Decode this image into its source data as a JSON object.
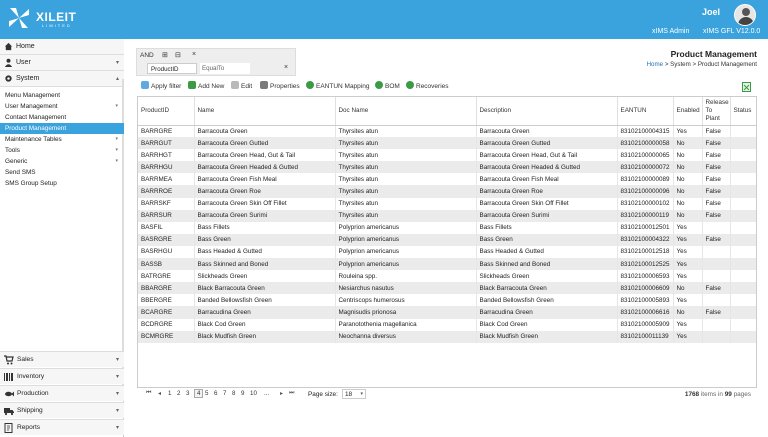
{
  "header": {
    "logo_text": "XILEIT",
    "logo_subtext": "LIMITED",
    "user_name": "Joel",
    "role": "xIMS Admin",
    "version": "xIMS GFL V12.0.0"
  },
  "sidebar": {
    "top": [
      {
        "label": "Home",
        "icon": "home-icon"
      },
      {
        "label": "User",
        "icon": "user-icon"
      },
      {
        "label": "System",
        "icon": "gear-icon"
      }
    ],
    "system_items": [
      {
        "label": "Menu Management",
        "chevron": false,
        "active": false
      },
      {
        "label": "User Management",
        "chevron": true,
        "active": false
      },
      {
        "label": "Contact Management",
        "chevron": false,
        "active": false
      },
      {
        "label": "Product Management",
        "chevron": false,
        "active": true
      },
      {
        "label": "Maintenance Tables",
        "chevron": true,
        "active": false
      },
      {
        "label": "Tools",
        "chevron": true,
        "active": false
      },
      {
        "label": "Generic",
        "chevron": true,
        "active": false
      },
      {
        "label": "Send SMS",
        "chevron": false,
        "active": false
      },
      {
        "label": "SMS Group Setup",
        "chevron": false,
        "active": false
      }
    ],
    "bottom": [
      {
        "label": "Sales",
        "icon": "cart-icon"
      },
      {
        "label": "Inventory",
        "icon": "barcode-icon"
      },
      {
        "label": "Production",
        "icon": "fish-icon"
      },
      {
        "label": "Shipping",
        "icon": "truck-icon"
      },
      {
        "label": "Reports",
        "icon": "report-icon"
      }
    ]
  },
  "filter_panel": {
    "logic": "AND",
    "field": "ProductID",
    "operator": "EqualTo"
  },
  "page": {
    "title": "Product Management",
    "breadcrumb_home": "Home",
    "breadcrumb_rest": " > System > Product Management"
  },
  "toolbar": {
    "apply_filter": "Apply filter",
    "add_new": "Add New",
    "edit": "Edit",
    "properties": "Properties",
    "eantun_mapping": "EANTUN Mapping",
    "bom": "BOM",
    "recoveries": "Recoveries"
  },
  "grid": {
    "columns": [
      "ProductID",
      "Name",
      "Doc Name",
      "Description",
      "EANTUN",
      "Enabled",
      "Release To Plant",
      "Status"
    ],
    "rows": [
      [
        "BARRGRE",
        "Barracouta Green",
        "Thyrsites atun",
        "Barracouta Green",
        "83102100004315",
        "Yes",
        "False",
        ""
      ],
      [
        "BARRGUT",
        "Barracouta Green Gutted",
        "Thyrsites atun",
        "Barracouta Green Gutted",
        "83102100000058",
        "No",
        "False",
        ""
      ],
      [
        "BARRHGT",
        "Barracouta Green Head, Gut & Tail",
        "Thyrsites atun",
        "Barracouta Green Head, Gut & Tail",
        "83102100000065",
        "No",
        "False",
        ""
      ],
      [
        "BARRHGU",
        "Barracouta Green Headed & Gutted",
        "Thyrsites atun",
        "Barracouta Green Headed & Gutted",
        "83102100000072",
        "No",
        "False",
        ""
      ],
      [
        "BARRMEA",
        "Barracouta Green Fish Meal",
        "Thyrsites atun",
        "Barracouta Green Fish Meal",
        "83102100000089",
        "No",
        "False",
        ""
      ],
      [
        "BARRROE",
        "Barracouta Green Roe",
        "Thyrsites atun",
        "Barracouta Green Roe",
        "83102100000096",
        "No",
        "False",
        ""
      ],
      [
        "BARRSKF",
        "Barracouta Green Skin Off Fillet",
        "Thyrsites atun",
        "Barracouta Green Skin Off Fillet",
        "83102100000102",
        "No",
        "False",
        ""
      ],
      [
        "BARRSUR",
        "Barracouta Green Surimi",
        "Thyrsites atun",
        "Barracouta Green Surimi",
        "83102100000119",
        "No",
        "False",
        ""
      ],
      [
        "BASFIL",
        "Bass Fillets",
        "Polyprion americanus",
        "Bass Fillets",
        "83102100012501",
        "Yes",
        "",
        ""
      ],
      [
        "BASRGRE",
        "Bass Green",
        "Polyprion americanus",
        "Bass Green",
        "83102100004322",
        "Yes",
        "False",
        ""
      ],
      [
        "BASRHGU",
        "Bass Headed & Gutted",
        "Polyprion americanus",
        "Bass Headed & Gutted",
        "83102100012518",
        "Yes",
        "",
        ""
      ],
      [
        "BASSB",
        "Bass Skinned and Boned",
        "Polyprion americanus",
        "Bass Skinned and Boned",
        "83102100012525",
        "Yes",
        "",
        ""
      ],
      [
        "BATRGRE",
        "Slickheads Green",
        "Rouleina spp.",
        "Slickheads Green",
        "83102100006593",
        "Yes",
        "",
        ""
      ],
      [
        "BBARGRE",
        "Black Barracouta Green",
        "Nesiarchus nasutus",
        "Black Barracouta Green",
        "83102100006609",
        "No",
        "False",
        ""
      ],
      [
        "BBERGRE",
        "Banded Bellowsfish Green",
        "Centriscops humerosus",
        "Banded Bellowsfish Green",
        "83102100005893",
        "Yes",
        "",
        ""
      ],
      [
        "BCARGRE",
        "Barracudina Green",
        "Magnisudis prionosa",
        "Barracudina Green",
        "83102100006616",
        "No",
        "False",
        ""
      ],
      [
        "BCDRGRE",
        "Black Cod Green",
        "Paranotothenia magellanica",
        "Black Cod Green",
        "83102100005909",
        "Yes",
        "",
        ""
      ],
      [
        "BCMRGRE",
        "Black Mudfish Green",
        "Neochanna diversus",
        "Black Mudfish Green",
        "83102100011139",
        "Yes",
        "",
        ""
      ]
    ]
  },
  "pager": {
    "pages": [
      "1",
      "2",
      "3",
      "4",
      "5",
      "6",
      "7",
      "8",
      "9",
      "10",
      "..."
    ],
    "current_page": "4",
    "page_size_label": "Page size:",
    "page_size": "18",
    "total_items": "1768",
    "items_in": " items in ",
    "total_pages": "99",
    "pages_word": " pages"
  },
  "colors": {
    "header_blue": "#3aa2dc",
    "active_item": "#3aa2dc",
    "link_blue": "#1f73b7",
    "row_alt": "#ebebeb"
  }
}
